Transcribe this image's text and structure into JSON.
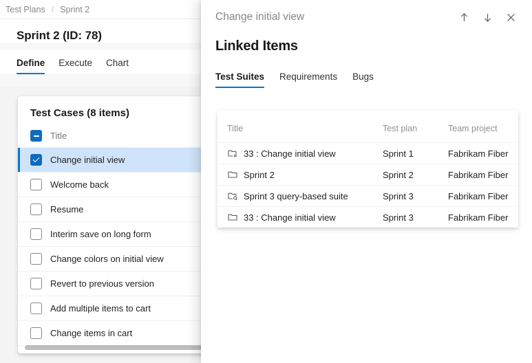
{
  "breadcrumb": {
    "root": "Test Plans",
    "separator": "/",
    "current": "Sprint 2"
  },
  "page": {
    "title": "Sprint 2 (ID: 78)",
    "tabs": [
      {
        "label": "Define",
        "active": true
      },
      {
        "label": "Execute",
        "active": false
      },
      {
        "label": "Chart",
        "active": false
      }
    ]
  },
  "test_cases": {
    "header": "Test Cases (8 items)",
    "select_all_label": "Title",
    "select_all_state": "indeterminate",
    "rows": [
      {
        "label": "Change initial view",
        "checked": true,
        "selected": true
      },
      {
        "label": "Welcome back",
        "checked": false,
        "selected": false
      },
      {
        "label": "Resume",
        "checked": false,
        "selected": false
      },
      {
        "label": "Interim save on long form",
        "checked": false,
        "selected": false
      },
      {
        "label": "Change colors on initial view",
        "checked": false,
        "selected": false
      },
      {
        "label": "Revert to previous version",
        "checked": false,
        "selected": false
      },
      {
        "label": "Add multiple items to cart",
        "checked": false,
        "selected": false
      },
      {
        "label": "Change items in cart",
        "checked": false,
        "selected": false
      }
    ]
  },
  "panel": {
    "header_title": "Change initial view",
    "actions": [
      {
        "name": "previous-item",
        "icon": "arrow-up-icon"
      },
      {
        "name": "next-item",
        "icon": "arrow-down-icon"
      },
      {
        "name": "close",
        "icon": "close-icon"
      }
    ],
    "title": "Linked Items",
    "tabs": [
      {
        "label": "Test Suites",
        "active": true
      },
      {
        "label": "Requirements",
        "active": false
      },
      {
        "label": "Bugs",
        "active": false
      }
    ],
    "table": {
      "columns": [
        "Title",
        "Test plan",
        "Team project"
      ],
      "rows": [
        {
          "icon": "static-suite-icon",
          "title": "33 : Change initial view",
          "test_plan": "Sprint 1",
          "team_project": "Fabrikam Fiber"
        },
        {
          "icon": "folder-suite-icon",
          "title": "Sprint 2",
          "test_plan": "Sprint 2",
          "team_project": "Fabrikam Fiber"
        },
        {
          "icon": "query-based-suite-icon",
          "title": "Sprint 3 query-based suite",
          "test_plan": "Sprint 3",
          "team_project": "Fabrikam Fiber"
        },
        {
          "icon": "folder-suite-icon",
          "title": "33 : Change initial view",
          "test_plan": "Sprint 3",
          "team_project": "Fabrikam Fiber"
        }
      ]
    }
  },
  "colors": {
    "accent": "#0078d4",
    "checkbox": "#0f6cbd",
    "selected_row": "#cfe4fa"
  }
}
